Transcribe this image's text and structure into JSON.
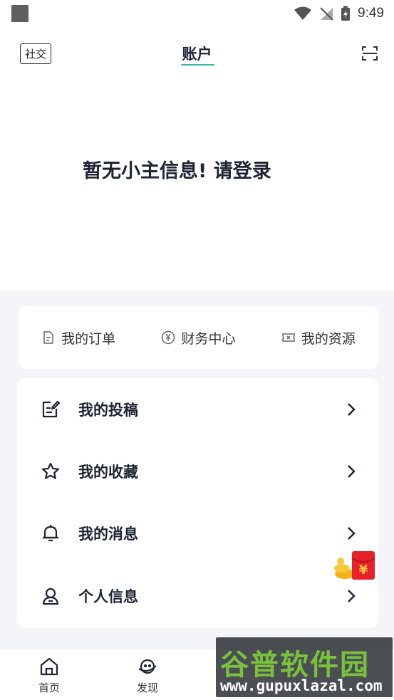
{
  "status_bar": {
    "time": "9:49"
  },
  "header": {
    "social_label": "社交",
    "title": "账户"
  },
  "login_prompt": "暂无小主信息! 请登录",
  "quick_actions": [
    {
      "label": "我的订单",
      "icon": "order-document-icon"
    },
    {
      "label": "财务中心",
      "icon": "yen-coin-icon"
    },
    {
      "label": "我的资源",
      "icon": "ticket-icon"
    }
  ],
  "menu": [
    {
      "label": "我的投稿",
      "icon": "edit-document-icon"
    },
    {
      "label": "我的收藏",
      "icon": "star-icon"
    },
    {
      "label": "我的消息",
      "icon": "bell-icon"
    },
    {
      "label": "个人信息",
      "icon": "user-icon"
    }
  ],
  "bottom_nav": [
    {
      "label": "首页",
      "icon": "home-icon"
    },
    {
      "label": "发现",
      "icon": "planet-face-icon"
    }
  ],
  "watermark": {
    "main": "谷普软件园",
    "sub": "www.gupuxlazal.com"
  },
  "colors": {
    "accent": "#36b6a9",
    "text_primary": "#1d2433",
    "background_grey": "#f4f5f8",
    "red_packet": "#e8202a"
  }
}
